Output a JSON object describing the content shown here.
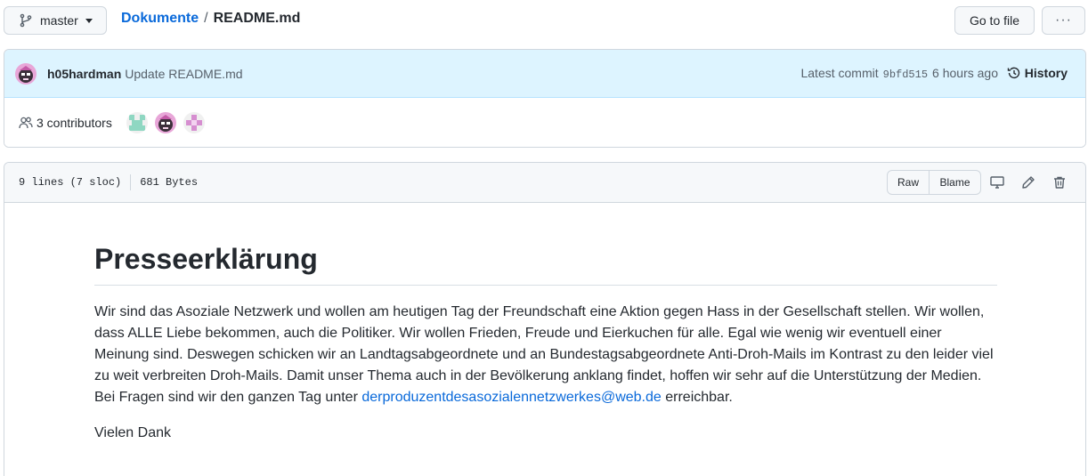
{
  "branch": {
    "name": "master"
  },
  "breadcrumb": {
    "repo": "Dokumente",
    "separator": "/",
    "file": "README.md"
  },
  "actions": {
    "goto_file": "Go to file",
    "more": "···"
  },
  "commit": {
    "author": "h05hardman",
    "message": "Update README.md",
    "latest_label": "Latest commit",
    "sha": "9bfd515",
    "time": "6 hours ago",
    "history_label": "History"
  },
  "contributors": {
    "label": "3 contributors"
  },
  "file": {
    "lines": "9 lines (7 sloc)",
    "size": "681 Bytes",
    "raw_label": "Raw",
    "blame_label": "Blame"
  },
  "readme": {
    "title": "Presseerklärung",
    "paragraph_text": "Wir sind das Asoziale Netzwerk und wollen am heutigen Tag der Freundschaft eine Aktion gegen Hass in der Gesellschaft stellen. Wir wollen, dass ALLE Liebe bekommen, auch die Politiker. Wir wollen Frieden, Freude und Eierkuchen für alle. Egal wie wenig wir eventuell einer Meinung sind. Deswegen schicken wir an Landtagsabgeordnete und an Bundestagsabgeordnete Anti-Droh-Mails im Kontrast zu den leider viel zu weit verbreiten Droh-Mails. Damit unser Thema auch in der Bevölkerung anklang findet, hoffen wir sehr auf die Unterstützung der Medien. Bei Fragen sind wir den ganzen Tag unter ",
    "email": "derproduzentdesasozialennetzwerkes@web.de",
    "paragraph_end": " erreichbar.",
    "closing": "Vielen Dank"
  },
  "colors": {
    "link": "#0969da",
    "commit_bg": "#ddf4ff",
    "border": "#d0d7de"
  }
}
